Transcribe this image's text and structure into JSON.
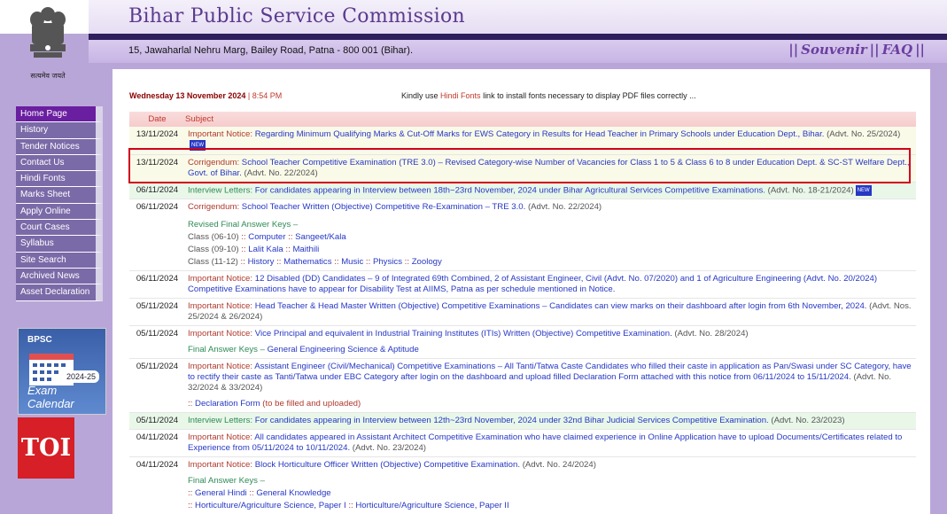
{
  "header": {
    "title": "Bihar Public Service Commission",
    "address": "15, Jawaharlal Nehru Marg, Bailey Road, Patna - 800 001 (Bihar).",
    "emblem_motto": "सत्यमेव जयते",
    "links": [
      "Souvenir",
      "FAQ"
    ],
    "separator": "||"
  },
  "datebar": {
    "date": "Wednesday 13 November 2024",
    "sep": "|",
    "time": "8:54 PM"
  },
  "hint": {
    "pre": "Kindly use ",
    "highlight": "Hindi Fonts",
    "post": " link to install fonts necessary to display PDF files correctly ..."
  },
  "sidebar": {
    "items": [
      "Home Page",
      "History",
      "Tender Notices",
      "Contact Us",
      "Hindi Fonts",
      "Marks Sheet",
      "Apply Online",
      "Court Cases",
      "Syllabus",
      "Site Search",
      "Archived News",
      "Asset Declaration"
    ]
  },
  "exam_calendar": {
    "brand": "BPSC",
    "year": "2024-25",
    "label": "Exam Calendar"
  },
  "watermark": "TOI",
  "table": {
    "headers": {
      "date": "Date",
      "subject": "Subject"
    },
    "new_badge": "NEW",
    "rows": [
      {
        "date": "13/11/2024",
        "tag": "Important Notice:",
        "text": "Regarding Minimum Qualifying Marks & Cut-Off Marks for EWS Category in Results for Head Teacher in Primary Schools under Education Dept., Bihar.",
        "advt": "(Advt. No. 25/2024)"
      },
      {
        "date": "13/11/2024",
        "tag": "Corrigendum:",
        "text": "School Teacher Competitive Examination (TRE 3.0) – Revised Category-wise Number of Vacancies for Class 1 to 5 & Class 6 to 8 under Education Dept. & SC-ST Welfare Dept., Govt. of Bihar.",
        "advt": "(Advt. No. 22/2024)"
      },
      {
        "date": "06/11/2024",
        "tag": "Interview Letters:",
        "text": "For candidates appearing in Interview between 18th~23rd November, 2024 under Bihar Agricultural Services Competitive Examinations.",
        "advt": "(Advt. No. 18-21/2024)"
      },
      {
        "date": "06/11/2024",
        "tag": "Corrigendum:",
        "text": "School Teacher Written (Objective) Competitive Re-Examination – TRE 3.0.",
        "advt": "(Advt. No. 22/2024)",
        "subhead": "Revised Final Answer Keys –",
        "lines": [
          {
            "cls": "Class (06-10)",
            "a": "Computer",
            "b": "Sangeet/Kala"
          },
          {
            "cls": "Class (09-10)",
            "a": "Lalit Kala",
            "b": "Maithili"
          },
          {
            "cls": "Class (11-12)",
            "a": "History",
            "b": "Mathematics",
            "c": "Music",
            "d": "Physics",
            "e": "Zoology"
          }
        ]
      },
      {
        "date": "06/11/2024",
        "tag": "Important Notice:",
        "text": "12 Disabled (DD) Candidates – 9 of Integrated 69th Combined, 2 of Assistant Engineer, Civil (Advt. No. 07/2020) and 1 of Agriculture Engineering (Advt. No. 20/2024) Competitive Examinations have to appear for Disability Test at AIIMS, Patna as per schedule mentioned in Notice."
      },
      {
        "date": "05/11/2024",
        "tag": "Important Notice:",
        "text": "Head Teacher & Head Master Written (Objective) Competitive Examinations – Candidates can view marks on their dashboard after login from 6th November, 2024.",
        "advt": "(Advt. Nos. 25/2024 & 26/2024)"
      },
      {
        "date": "05/11/2024",
        "tag": "Important Notice:",
        "text": "Vice Principal and equivalent in Industrial Training Institutes (ITIs) Written (Objective) Competitive Examination.",
        "advt": "(Advt. No. 28/2024)",
        "subhead": "Final Answer Keys –",
        "subtext": "General Engineering Science & Aptitude"
      },
      {
        "date": "05/11/2024",
        "tag": "Important Notice:",
        "text": "Assistant Engineer (Civil/Mechanical) Competitive Examinations – All Tanti/Tatwa Caste Candidates who filled their caste in application as Pan/Swasi under SC Category, have to rectify their caste as Tanti/Tatwa under EBC Category after login on the dashboard and upload filled Declaration Form attached with this notice from 06/11/2024 to 15/11/2024.",
        "advt": "(Advt. No. 32/2024 & 33/2024)",
        "decl": "Declaration Form",
        "decl_note": "(to be filled and uploaded)"
      },
      {
        "date": "05/11/2024",
        "tag": "Interview Letters:",
        "text": "For candidates appearing in Interview between 12th~23rd November, 2024 under 32nd Bihar Judicial Services Competitive Examination.",
        "advt": "(Advt. No. 23/2023)"
      },
      {
        "date": "04/11/2024",
        "tag": "Important Notice:",
        "text": "All candidates appeared in Assistant Architect Competitive Examination who have claimed experience in Online Application have to upload Documents/Certificates related to Experience from 05/11/2024 to 10/11/2024.",
        "advt": "(Advt. No. 23/2024)"
      },
      {
        "date": "04/11/2024",
        "tag": "Important Notice:",
        "text": "Block Horticulture Officer Written (Objective) Competitive Examination.",
        "advt": "(Advt. No. 24/2024)",
        "subhead": "Final Answer Keys –",
        "keys": [
          "General Hindi",
          "General Knowledge",
          "Horticulture/Agriculture Science, Paper I",
          "Horticulture/Agriculture Science, Paper II"
        ]
      }
    ]
  },
  "colors": {
    "accent": "#6a1ea0",
    "highlight_box": "#d0021b",
    "link": "#2638c4",
    "tag": "#b03a2e"
  }
}
